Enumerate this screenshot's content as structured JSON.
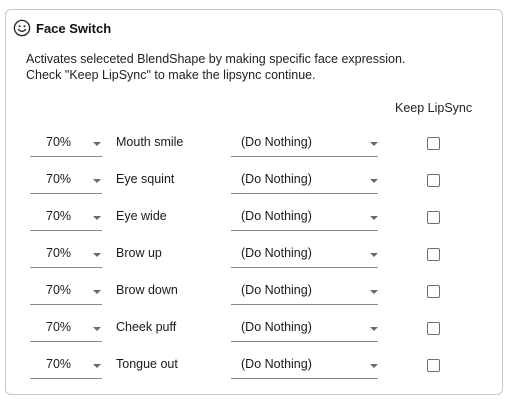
{
  "panel": {
    "title": "Face Switch",
    "title_icon": "smiley-face-icon",
    "description_lines": [
      "Activates seleceted BlendShape by making specific face expression.",
      "Check \"Keep LipSync\" to make the lipsync continue."
    ],
    "column_header": "Keep LipSync"
  },
  "rows": [
    {
      "percent": "70%",
      "label": "Mouth smile",
      "action": "(Do Nothing)",
      "keep_lipsync": false
    },
    {
      "percent": "70%",
      "label": "Eye squint",
      "action": "(Do Nothing)",
      "keep_lipsync": false
    },
    {
      "percent": "70%",
      "label": "Eye wide",
      "action": "(Do Nothing)",
      "keep_lipsync": false
    },
    {
      "percent": "70%",
      "label": "Brow up",
      "action": "(Do Nothing)",
      "keep_lipsync": false
    },
    {
      "percent": "70%",
      "label": "Brow down",
      "action": "(Do Nothing)",
      "keep_lipsync": false
    },
    {
      "percent": "70%",
      "label": "Cheek puff",
      "action": "(Do Nothing)",
      "keep_lipsync": false
    },
    {
      "percent": "70%",
      "label": "Tongue out",
      "action": "(Do Nothing)",
      "keep_lipsync": false
    }
  ]
}
